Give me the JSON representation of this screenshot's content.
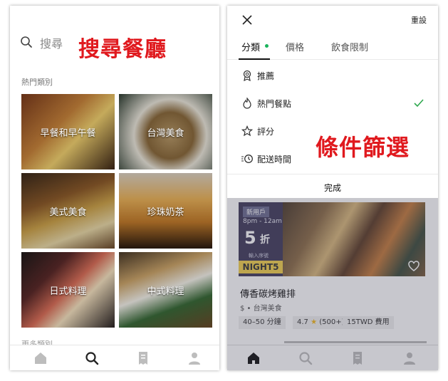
{
  "left": {
    "search": {
      "placeholder_text": "搜尋"
    },
    "headline": "搜尋餐廳",
    "section_label": "熱門類別",
    "categories": [
      {
        "label": "早餐和早午餐"
      },
      {
        "label": "台灣美食"
      },
      {
        "label": "美式美食"
      },
      {
        "label": "珍珠奶茶"
      },
      {
        "label": "日式料理"
      },
      {
        "label": "中式料理"
      }
    ],
    "partial_section_label": "更多類別",
    "tabbar": {
      "items": [
        "home-icon",
        "search-icon",
        "receipt-icon",
        "account-icon"
      ],
      "active_index": 1
    }
  },
  "right": {
    "close_label": "close-icon",
    "reset_label": "重設",
    "filter_tabs": [
      {
        "label": "分類",
        "active": true,
        "has_dot": true
      },
      {
        "label": "價格"
      },
      {
        "label": "飲食限制"
      }
    ],
    "options": [
      {
        "label": "推薦",
        "icon": "badge-icon",
        "checked": false
      },
      {
        "label": "熱門餐點",
        "icon": "flame-icon",
        "checked": true
      },
      {
        "label": "評分",
        "icon": "star-icon",
        "checked": false
      },
      {
        "label": "配送時間",
        "icon": "clock-icon",
        "checked": false
      }
    ],
    "headline": "條件篩選",
    "done_label": "完成",
    "restaurant": {
      "promo": {
        "badge": "新用戶",
        "time": "8pm - 12am",
        "discount_number": "5",
        "discount_unit": "折",
        "code_label": "輸入序號",
        "code": "NIGHT5"
      },
      "name": "傳香碳烤雞排",
      "meta": "$ • 台灣美食",
      "chips": [
        "40–50 分鐘",
        "4.7",
        "(500+)",
        "15TWD 費用"
      ]
    },
    "tabbar": {
      "items": [
        "home-icon",
        "search-icon",
        "receipt-icon",
        "account-icon"
      ],
      "active_index": 0
    }
  },
  "colors": {
    "highlight_red": "#e0191e",
    "active_green": "#19b35b",
    "check_green": "#2fa84f",
    "promo_yellow": "#f2d04b"
  }
}
